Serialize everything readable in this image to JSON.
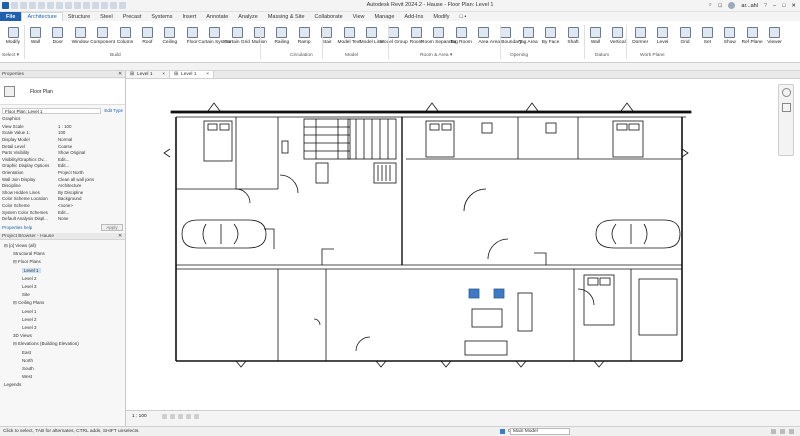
{
  "window": {
    "title": "Autodesk Revit 2024.2 - Hause - Floor Plan: Level 1",
    "user": "ar...ahl"
  },
  "ribbon_tabs": [
    "File",
    "Architecture",
    "Structure",
    "Steel",
    "Precast",
    "Systems",
    "Insert",
    "Annotate",
    "Analyze",
    "Massing & Site",
    "Collaborate",
    "View",
    "Manage",
    "Add-Ins",
    "Modify",
    "□ •"
  ],
  "ribbon": {
    "buttons": [
      {
        "label": "Modify"
      },
      {
        "label": "Wall"
      },
      {
        "label": "Door"
      },
      {
        "label": "Window"
      },
      {
        "label": "Component"
      },
      {
        "label": "Column"
      },
      {
        "label": "Roof"
      },
      {
        "label": "Ceiling"
      },
      {
        "label": "Floor"
      },
      {
        "label": "Curtain System"
      },
      {
        "label": "Curtain Grid"
      },
      {
        "label": "Mullion"
      },
      {
        "label": "Railing"
      },
      {
        "label": "Ramp"
      },
      {
        "label": "Stair"
      },
      {
        "label": "Model Text"
      },
      {
        "label": "Model Line"
      },
      {
        "label": "Model Group"
      },
      {
        "label": "Room"
      },
      {
        "label": "Room Separator"
      },
      {
        "label": "Tag Room"
      },
      {
        "label": "Area"
      },
      {
        "label": "Area Boundary"
      },
      {
        "label": "Tag Area"
      },
      {
        "label": "By Face"
      },
      {
        "label": "Shaft"
      },
      {
        "label": "Wall"
      },
      {
        "label": "Vertical"
      },
      {
        "label": "Dormer"
      },
      {
        "label": "Level"
      },
      {
        "label": "Grid"
      },
      {
        "label": "Set"
      },
      {
        "label": "Show"
      },
      {
        "label": "Ref Plane"
      },
      {
        "label": "Viewer"
      }
    ],
    "panels": [
      "Select ▾",
      "Build",
      "Circulation",
      "Model",
      "Room & Area ▾",
      "Opening",
      "Datum",
      "Work Plane"
    ]
  },
  "properties": {
    "header": "Properties",
    "type_name": "Floor Plan",
    "instance_selector": "Floor Plan: Level 1",
    "edit_type": "Edit Type",
    "section": "Graphics",
    "rows": [
      {
        "k": "View Scale",
        "v": "1 : 100"
      },
      {
        "k": "Scale Value 1:",
        "v": "100"
      },
      {
        "k": "Display Model",
        "v": "Normal"
      },
      {
        "k": "Detail Level",
        "v": "Coarse"
      },
      {
        "k": "Parts Visibility",
        "v": "Show Original"
      },
      {
        "k": "Visibility/Graphics Ov...",
        "v": "Edit..."
      },
      {
        "k": "Graphic Display Options",
        "v": "Edit..."
      },
      {
        "k": "Orientation",
        "v": "Project North"
      },
      {
        "k": "Wall Join Display",
        "v": "Clean all wall joins"
      },
      {
        "k": "Discipline",
        "v": "Architecture"
      },
      {
        "k": "Show Hidden Lines",
        "v": "By Discipline"
      },
      {
        "k": "Color Scheme Location",
        "v": "Background"
      },
      {
        "k": "Color Scheme",
        "v": "<none>"
      },
      {
        "k": "System Color Schemes",
        "v": "Edit..."
      },
      {
        "k": "Default Analysis Displ...",
        "v": "None"
      }
    ],
    "help_link": "Properties help",
    "apply": "Apply"
  },
  "browser": {
    "header": "Project Browser - Hause",
    "items": [
      {
        "t": "⊟ [o] Views (all)",
        "d": 0
      },
      {
        "t": "Structural Plans",
        "d": 1
      },
      {
        "t": "⊟ Floor Plans",
        "d": 1
      },
      {
        "t": "Level 1",
        "d": 2,
        "sel": true
      },
      {
        "t": "Level 2",
        "d": 2
      },
      {
        "t": "Level 3",
        "d": 2
      },
      {
        "t": "Site",
        "d": 2
      },
      {
        "t": "⊟ Ceiling Plans",
        "d": 1
      },
      {
        "t": "Level 1",
        "d": 2
      },
      {
        "t": "Level 2",
        "d": 2
      },
      {
        "t": "Level 3",
        "d": 2
      },
      {
        "t": "3D Views",
        "d": 1
      },
      {
        "t": "⊟ Elevations (Building Elevation)",
        "d": 1
      },
      {
        "t": "East",
        "d": 2
      },
      {
        "t": "North",
        "d": 2
      },
      {
        "t": "South",
        "d": 2
      },
      {
        "t": "West",
        "d": 2
      },
      {
        "t": "Legends",
        "d": 0
      }
    ]
  },
  "view_tabs": [
    {
      "label": "Level 1",
      "active": false
    },
    {
      "label": "Level 1",
      "active": true
    }
  ],
  "view_control": {
    "scale": "1 : 100"
  },
  "status": {
    "hint": "Click to select, TAB for alternates, CTRL adds, SHIFT unselects.",
    "model": "Main Model",
    "workset": "0"
  },
  "colors": {
    "accent": "#1f5fae",
    "blue_icon": "#3d79c4"
  }
}
